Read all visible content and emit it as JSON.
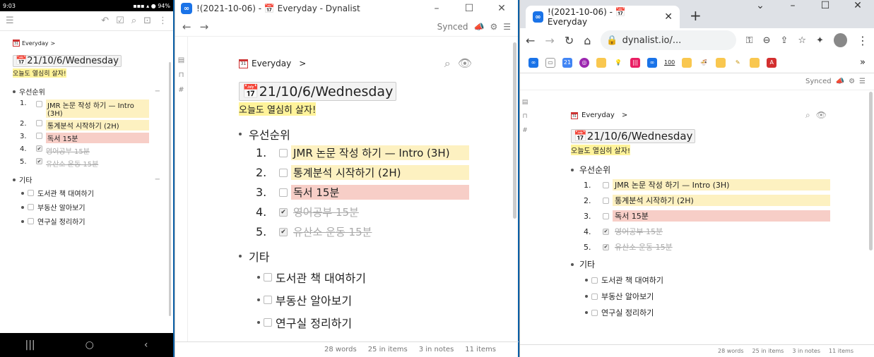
{
  "doc": {
    "breadcrumb": "Everyday",
    "breadcrumb_sep": ">",
    "title": "21/10/6/Wednesday",
    "note": "오늘도 열심히 살자!",
    "section1": {
      "label": "우선순위"
    },
    "priorities": [
      {
        "num": "1.",
        "text": "JMR 논문 작성 하기 — Intro (3H)",
        "checked": false
      },
      {
        "num": "2.",
        "text": "통계분석 시작하기 (2H)",
        "checked": false
      },
      {
        "num": "3.",
        "text": "독서 15분",
        "checked": false
      },
      {
        "num": "4.",
        "text": "영어공부 15분",
        "checked": true
      },
      {
        "num": "5.",
        "text": "유산소 운동 15분",
        "checked": true
      }
    ],
    "section2": {
      "label": "기타"
    },
    "others": [
      {
        "text": "도서관 책 대여하기"
      },
      {
        "text": "부동산 알아보기"
      },
      {
        "text": "연구실 정리하기"
      }
    ]
  },
  "phone": {
    "time": "9:03",
    "battery": "94%",
    "title_line1": "JMR 논문 작성 하기 — Intro",
    "title_line2": "(3H)"
  },
  "app": {
    "window_title": "!(2021-10-06)  - 📅 Everyday - Dynalist",
    "synced": "Synced"
  },
  "chrome": {
    "tab_title": "!(2021-10-06) - 📅 Everyday",
    "url": "dynalist.io/...",
    "synced": "Synced",
    "bookmark_100": "100"
  },
  "footer": {
    "words": "28 words",
    "in_items": "25 in items",
    "in_notes": "3 in notes",
    "items": "11 items"
  },
  "colors": {
    "highlight_yellow": "#fff39a",
    "item_yellow": "#fdf1c1",
    "item_red": "#f7cec7",
    "dynalist_blue": "#1a73e8"
  }
}
